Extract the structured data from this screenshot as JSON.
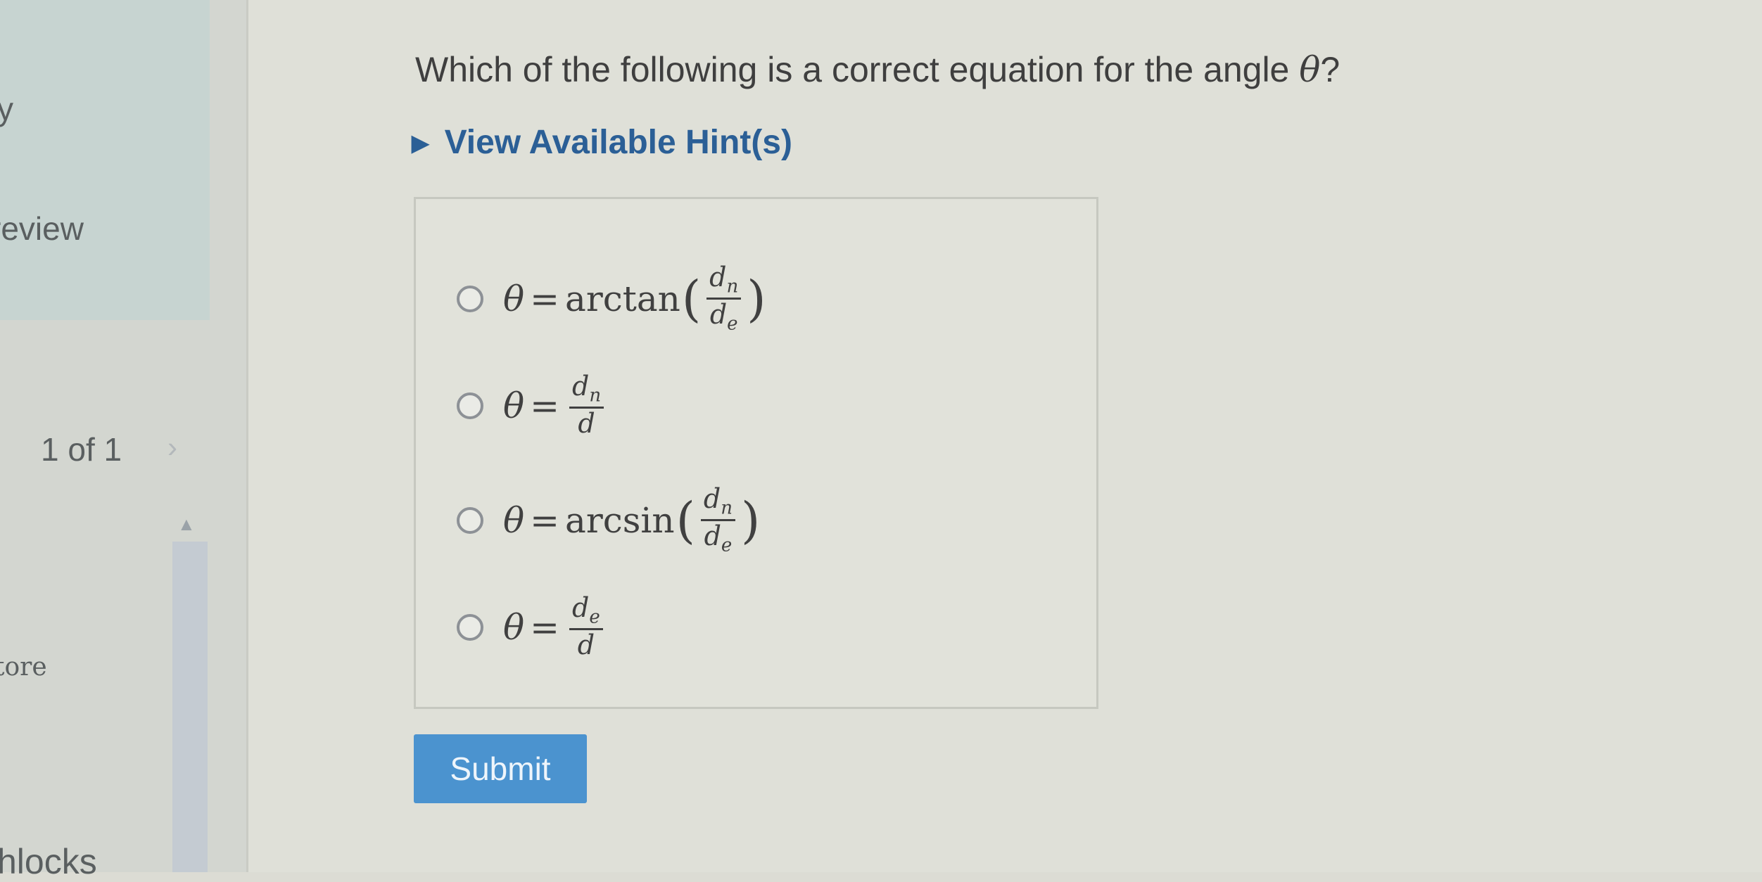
{
  "sidebar": {
    "fragment_y": "y",
    "review_text": "review",
    "pagination": "1 of 1",
    "next_chevron": "›",
    "score_text": "tore",
    "blocks_text": "hlocks"
  },
  "question": {
    "text": "Which of the following is a correct equation for the angle ",
    "symbol": "θ",
    "suffix": "?"
  },
  "hint": {
    "label": "View Available Hint(s)",
    "icon": "triangle-right-icon"
  },
  "options": [
    {
      "lhs": "θ",
      "eq": "=",
      "func": "arctan",
      "num": "dn",
      "den": "de",
      "parens": true
    },
    {
      "lhs": "θ",
      "eq": "=",
      "func": "",
      "num": "dn",
      "den": "d",
      "parens": false
    },
    {
      "lhs": "θ",
      "eq": "=",
      "func": "arcsin",
      "num": "dn",
      "den": "de",
      "parens": true
    },
    {
      "lhs": "θ",
      "eq": "=",
      "func": "",
      "num": "de",
      "den": "d",
      "parens": false
    }
  ],
  "submit": {
    "label": "Submit"
  },
  "colors": {
    "accent": "#4b93cf",
    "hint": "#2b5f96"
  }
}
